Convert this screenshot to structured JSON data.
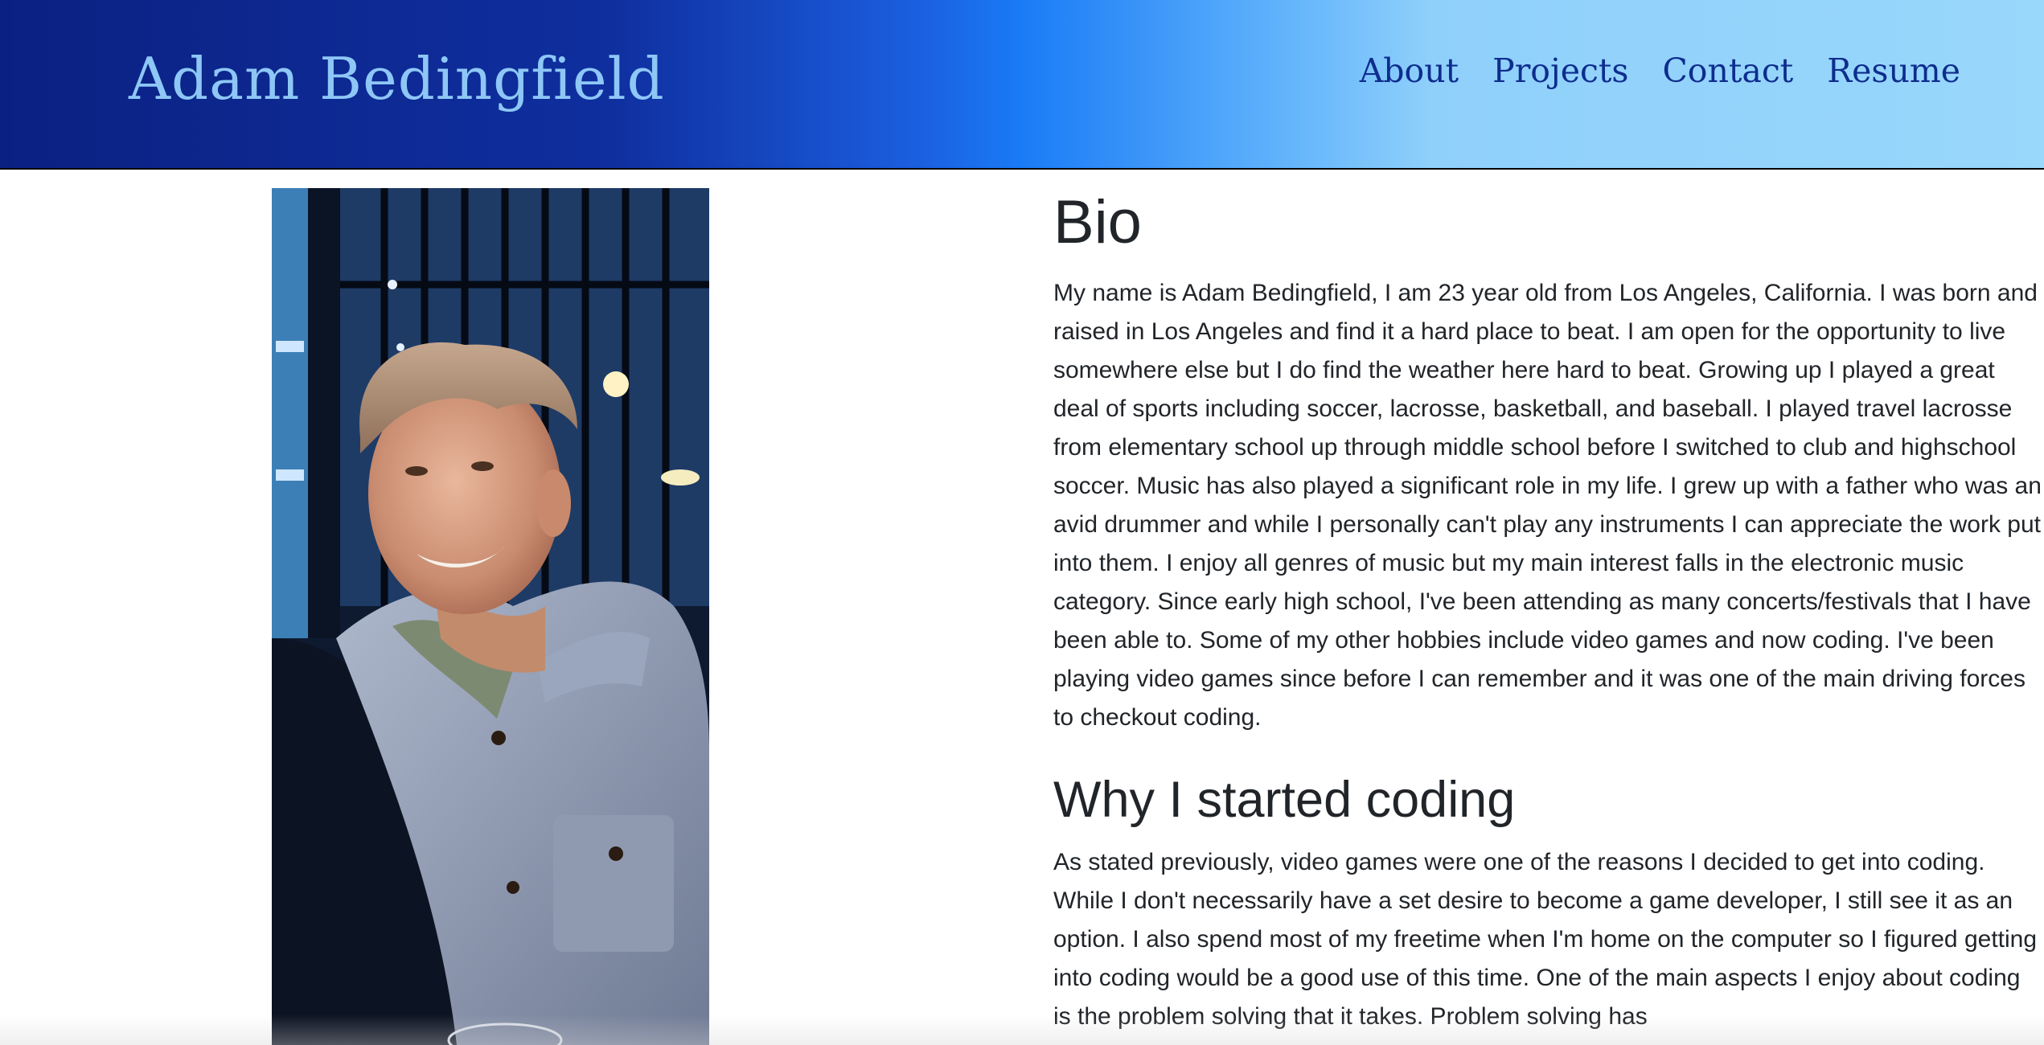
{
  "header": {
    "brand": "Adam Bedingfield",
    "nav": [
      {
        "label": "About"
      },
      {
        "label": "Projects"
      },
      {
        "label": "Contact"
      },
      {
        "label": "Resume"
      }
    ]
  },
  "colors": {
    "header_gradient_start": "#0b2182",
    "header_gradient_mid": "#1a7bf6",
    "header_gradient_end": "#99d7fb",
    "brand_text": "#8ec7f6",
    "nav_text": "#0e2d8d",
    "body_text": "#212529"
  },
  "portrait": {
    "icon": "profile-photo"
  },
  "bio": {
    "heading": "Bio",
    "text": "My name is Adam Bedingfield, I am 23 year old from Los Angeles, California. I was born and raised in Los Angeles and find it a hard place to beat. I am open for the opportunity to live somewhere else but I do find the weather here hard to beat. Growing up I played a great deal of sports including soccer, lacrosse, basketball, and baseball. I played travel lacrosse from elementary school up through middle school before I switched to club and highschool soccer. Music has also played a significant role in my life. I grew up with a father who was an avid drummer and while I personally can't play any instruments I can appreciate the work put into them. I enjoy all genres of music but my main interest falls in the electronic music category. Since early high school, I've been attending as many concerts/festivals that I have been able to. Some of my other hobbies include video games and now coding. I've been playing video games since before I can remember and it was one of the main driving forces to checkout coding."
  },
  "coding": {
    "heading": "Why I started coding",
    "text": "As stated previously, video games were one of the reasons I decided to get into coding. While I don't necessarily have a set desire to become a game developer, I still see it as an option. I also spend most of my freetime when I'm home on the computer so I figured getting into coding would be a good use of this time. One of the main aspects I enjoy about coding is the problem solving that it takes. Problem solving has"
  }
}
